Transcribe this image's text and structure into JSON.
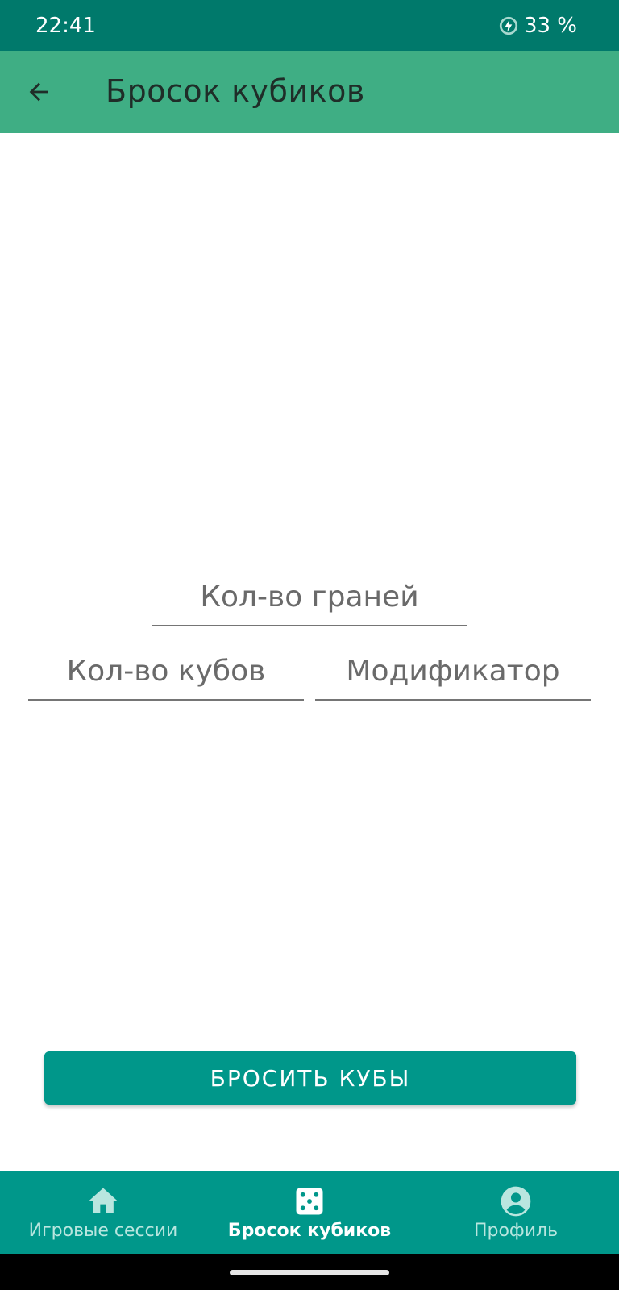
{
  "status": {
    "time": "22:41",
    "battery": "33 %"
  },
  "app_bar": {
    "title": "Бросок кубиков",
    "back_icon": "arrow-left-icon"
  },
  "form": {
    "faces_placeholder": "Кол-во граней",
    "dice_placeholder": "Кол-во кубов",
    "modifier_placeholder": "Модификатор"
  },
  "roll_button": {
    "label": "БРОСИТЬ КУБЫ"
  },
  "bottom_nav": {
    "items": [
      {
        "label": "Игровые сессии",
        "icon": "home-icon"
      },
      {
        "label": "Бросок кубиков",
        "icon": "dice-icon",
        "active": true
      },
      {
        "label": "Профиль",
        "icon": "account-icon"
      }
    ]
  },
  "colors": {
    "status_bar": "#00796b",
    "app_bar": "#3fae84",
    "accent": "#00978a"
  }
}
